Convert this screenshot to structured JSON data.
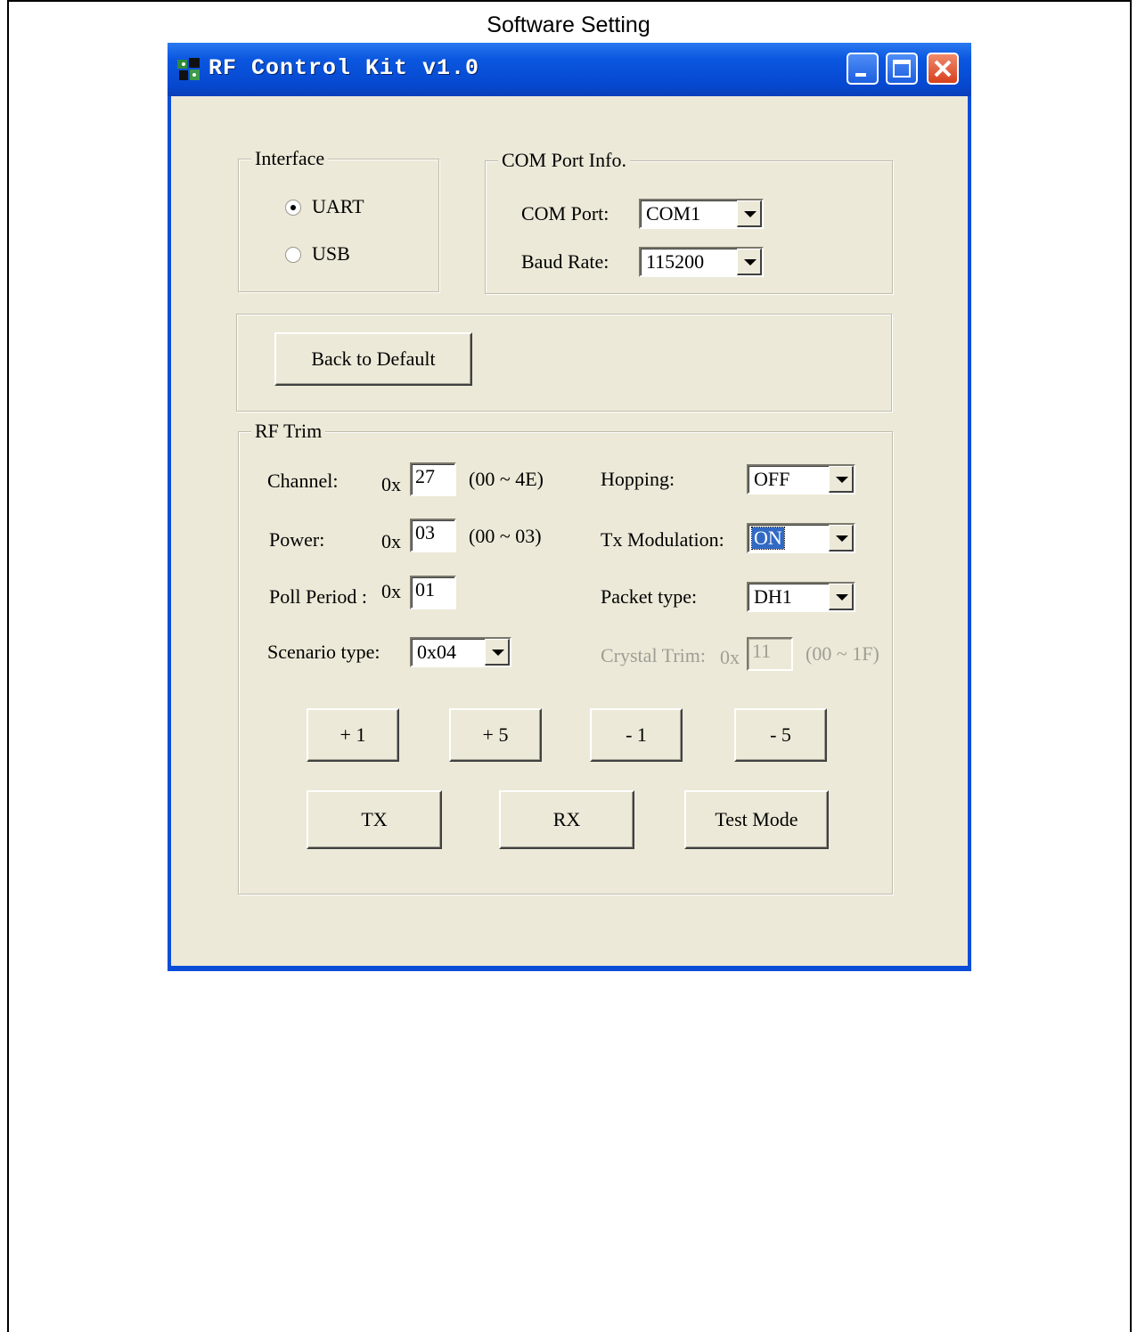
{
  "page": {
    "title": "Software Setting"
  },
  "window": {
    "title": "RF Control Kit v1.0"
  },
  "interface_group": {
    "legend": "Interface",
    "options": [
      {
        "label": "UART",
        "selected": true
      },
      {
        "label": "USB",
        "selected": false
      }
    ]
  },
  "com_group": {
    "legend": "COM Port Info.",
    "com_port_label": "COM Port:",
    "com_port_value": "COM1",
    "baud_rate_label": "Baud Rate:",
    "baud_rate_value": "115200"
  },
  "default_group": {
    "back_to_default": "Back to Default"
  },
  "rf_trim": {
    "legend": "RF Trim",
    "hex_prefix": "0x",
    "channel_label": "Channel:",
    "channel_value": "27",
    "channel_range": "(00 ~ 4E)",
    "power_label": "Power:",
    "power_value": "03",
    "power_range": "(00 ~ 03)",
    "poll_period_label": "Poll Period :",
    "poll_period_value": "01",
    "scenario_label": "Scenario type:",
    "scenario_value": "0x04",
    "hopping_label": "Hopping:",
    "hopping_value": "OFF",
    "tx_mod_label": "Tx Modulation:",
    "tx_mod_value": "ON",
    "packet_label": "Packet type:",
    "packet_value": "DH1",
    "crystal_label": "Crystal Trim:",
    "crystal_value": "11",
    "crystal_range": "(00 ~ 1F)",
    "buttons": {
      "plus1": "+ 1",
      "plus5": "+ 5",
      "minus1": "- 1",
      "minus5": "- 5"
    },
    "tx": "TX",
    "rx": "RX",
    "test_mode": "Test Mode"
  }
}
